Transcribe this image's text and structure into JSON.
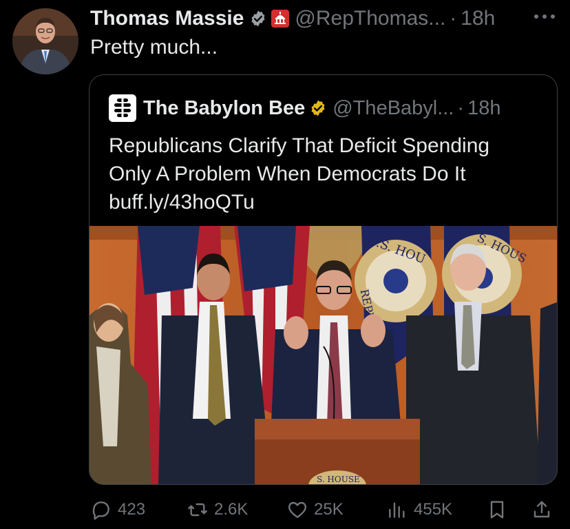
{
  "author": {
    "name": "Thomas Massie",
    "handle": "@RepThomas...",
    "time": "18h",
    "separator": "·"
  },
  "tweet": {
    "text": "Pretty much..."
  },
  "quoted": {
    "name": "The Babylon Bee",
    "handle": "@TheBabyl...",
    "time": "18h",
    "separator": "·",
    "line1": "Republicans Clarify That Deficit Spending",
    "line2": "Only A Problem When Democrats Do It",
    "link": "buff.ly/43hoQTu",
    "photo_signage": [
      "U.S. HOU",
      "S. HOUS",
      "REPRESE",
      "S. HOUSE"
    ]
  },
  "actions": {
    "replies": "423",
    "reposts": "2.6K",
    "likes": "25K",
    "views": "455K"
  },
  "colors": {
    "background": "#000000",
    "text": "#e7e9ea",
    "muted": "#71767b",
    "verified_blue": "#1d9bf0",
    "verified_gold": "#e2b719",
    "gov_red": "#d32f2f"
  },
  "icons": [
    "verified-badge-icon",
    "government-badge-icon",
    "more-icon",
    "bee-logo-icon",
    "reply-icon",
    "repost-icon",
    "like-icon",
    "views-icon",
    "bookmark-icon",
    "share-icon"
  ]
}
